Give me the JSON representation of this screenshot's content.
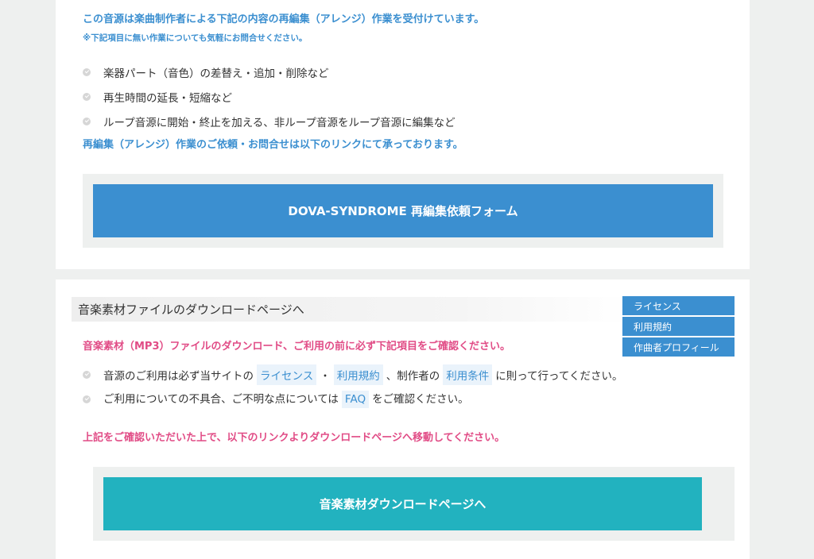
{
  "arrange": {
    "heading": "この音源は楽曲制作者による下記の内容の再編集（アレンジ）作業を受付けています。",
    "note": "※下記項目に無い作業についても気軽にお問合せください。",
    "items": [
      "楽器パート（音色）の差替え・追加・削除など",
      "再生時間の延長・短縮など",
      "ループ音源に開始・終止を加える、非ループ音源をループ音源に編集など"
    ],
    "contact_text": "再編集（アレンジ）作業のご依頼・お問合せは以下のリンクにて承っております。",
    "button_label": "DOVA-SYNDROME 再編集依頼フォーム",
    "button_color": "#3b8fd0"
  },
  "download": {
    "section_title": "音楽素材ファイルのダウンロードページへ",
    "warning": "音楽素材（MP3）ファイルのダウンロード、ご利用の前に必ず下記項目をご確認ください。",
    "item1": {
      "before": "音源のご利用は必ず当サイトの",
      "link_license": "ライセンス",
      "sep": "・",
      "link_terms": "利用規約",
      "mid": "、制作者の",
      "link_conditions": "利用条件",
      "after": "に則って行ってください。"
    },
    "item2": {
      "before": "ご利用についての不具合、ご不明な点については",
      "link_faq": "FAQ",
      "after": "をご確認ください。"
    },
    "move_text": "上記をご確認いただいた上で、以下のリンクよりダウンロードページへ移動してください。",
    "button_label": "音楽素材ダウンロードページへ",
    "button_color": "#22b2bf",
    "warning_color": "#e14c86"
  },
  "side_menu": [
    "ライセンス",
    "利用規約",
    "作曲者プロフィール"
  ]
}
